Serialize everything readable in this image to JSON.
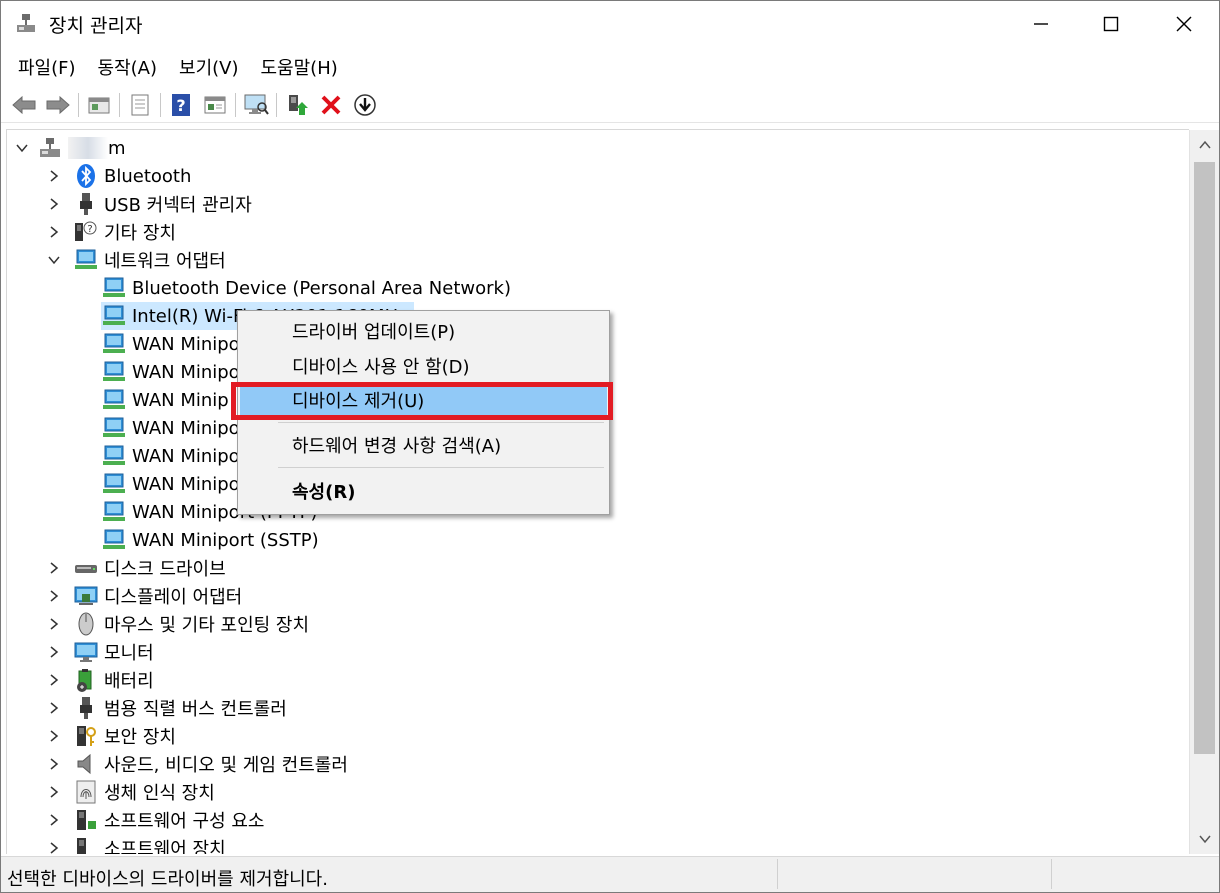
{
  "window": {
    "title": "장치 관리자",
    "controls": {
      "minimize": "minimize",
      "maximize": "maximize",
      "close": "close"
    }
  },
  "menu": [
    "파일(F)",
    "동작(A)",
    "보기(V)",
    "도움말(H)"
  ],
  "toolbar": [
    "back-arrow-icon",
    "forward-arrow-icon",
    "computer-view-icon",
    "properties-icon",
    "help-icon",
    "action-pane-icon",
    "monitor-scan-icon",
    "update-driver-icon",
    "uninstall-x-icon",
    "download-icon"
  ],
  "tree": {
    "root": "m",
    "categories_top": [
      {
        "label": "Bluetooth",
        "icon": "bluetooth-icon"
      },
      {
        "label": "USB 커넥터 관리자",
        "icon": "usb-plug-icon"
      },
      {
        "label": "기타 장치",
        "icon": "unknown-device-icon"
      },
      {
        "label": "네트워크 어댑터",
        "icon": "network-adapter-icon",
        "expanded": true
      }
    ],
    "network_children": [
      "Bluetooth Device (Personal Area Network)",
      "Intel(R) Wi-Fi 6 AX201 160MHz",
      "WAN Miniport (IKEv2)",
      "WAN Miniport (IP)",
      "WAN Miniport (IPv6)",
      "WAN Miniport (L2TP)",
      "WAN Miniport (Network Monitor)",
      "WAN Miniport (PPPOE)",
      "WAN Miniport (PPTP)",
      "WAN Miniport (SSTP)"
    ],
    "network_children_visible": [
      "Bluetooth Device (Personal Area Network)",
      "Intel(R) Wi-Fi 6 AX201 160MHz",
      "WAN Minipo",
      "WAN Minipo",
      "WAN Minip",
      "WAN Minipo",
      "WAN Minipo",
      "WAN Minipo",
      "WAN Miniport (PPTP)",
      "WAN Miniport (SSTP)"
    ],
    "categories_bottom": [
      {
        "label": "디스크 드라이브",
        "icon": "disk-drive-icon"
      },
      {
        "label": "디스플레이 어댑터",
        "icon": "display-adapter-icon"
      },
      {
        "label": "마우스 및 기타 포인팅 장치",
        "icon": "mouse-icon"
      },
      {
        "label": "모니터",
        "icon": "monitor-icon"
      },
      {
        "label": "배터리",
        "icon": "battery-icon"
      },
      {
        "label": "범용 직렬 버스 컨트롤러",
        "icon": "usb-controller-icon"
      },
      {
        "label": "보안 장치",
        "icon": "security-device-icon"
      },
      {
        "label": "사운드, 비디오 및 게임 컨트롤러",
        "icon": "speaker-icon"
      },
      {
        "label": "생체 인식 장치",
        "icon": "fingerprint-icon"
      },
      {
        "label": "소프트웨어 구성 요소",
        "icon": "software-component-icon"
      },
      {
        "label": "소프트웨어 장치",
        "icon": "software-device-icon"
      }
    ]
  },
  "context_menu": {
    "items": [
      "드라이버 업데이트(P)",
      "디바이스 사용 안 함(D)",
      "디바이스 제거(U)",
      "하드웨어 변경 사항 검색(A)",
      "속성(R)"
    ],
    "highlighted": "디바이스 제거(U)"
  },
  "status": {
    "text": "선택한 디바이스의 드라이버를 제거합니다."
  },
  "colors": {
    "highlight": "#91c9f7",
    "selection": "#cce8ff",
    "annotation_box": "#e21b23",
    "network_icon": "#2f8fd6"
  }
}
